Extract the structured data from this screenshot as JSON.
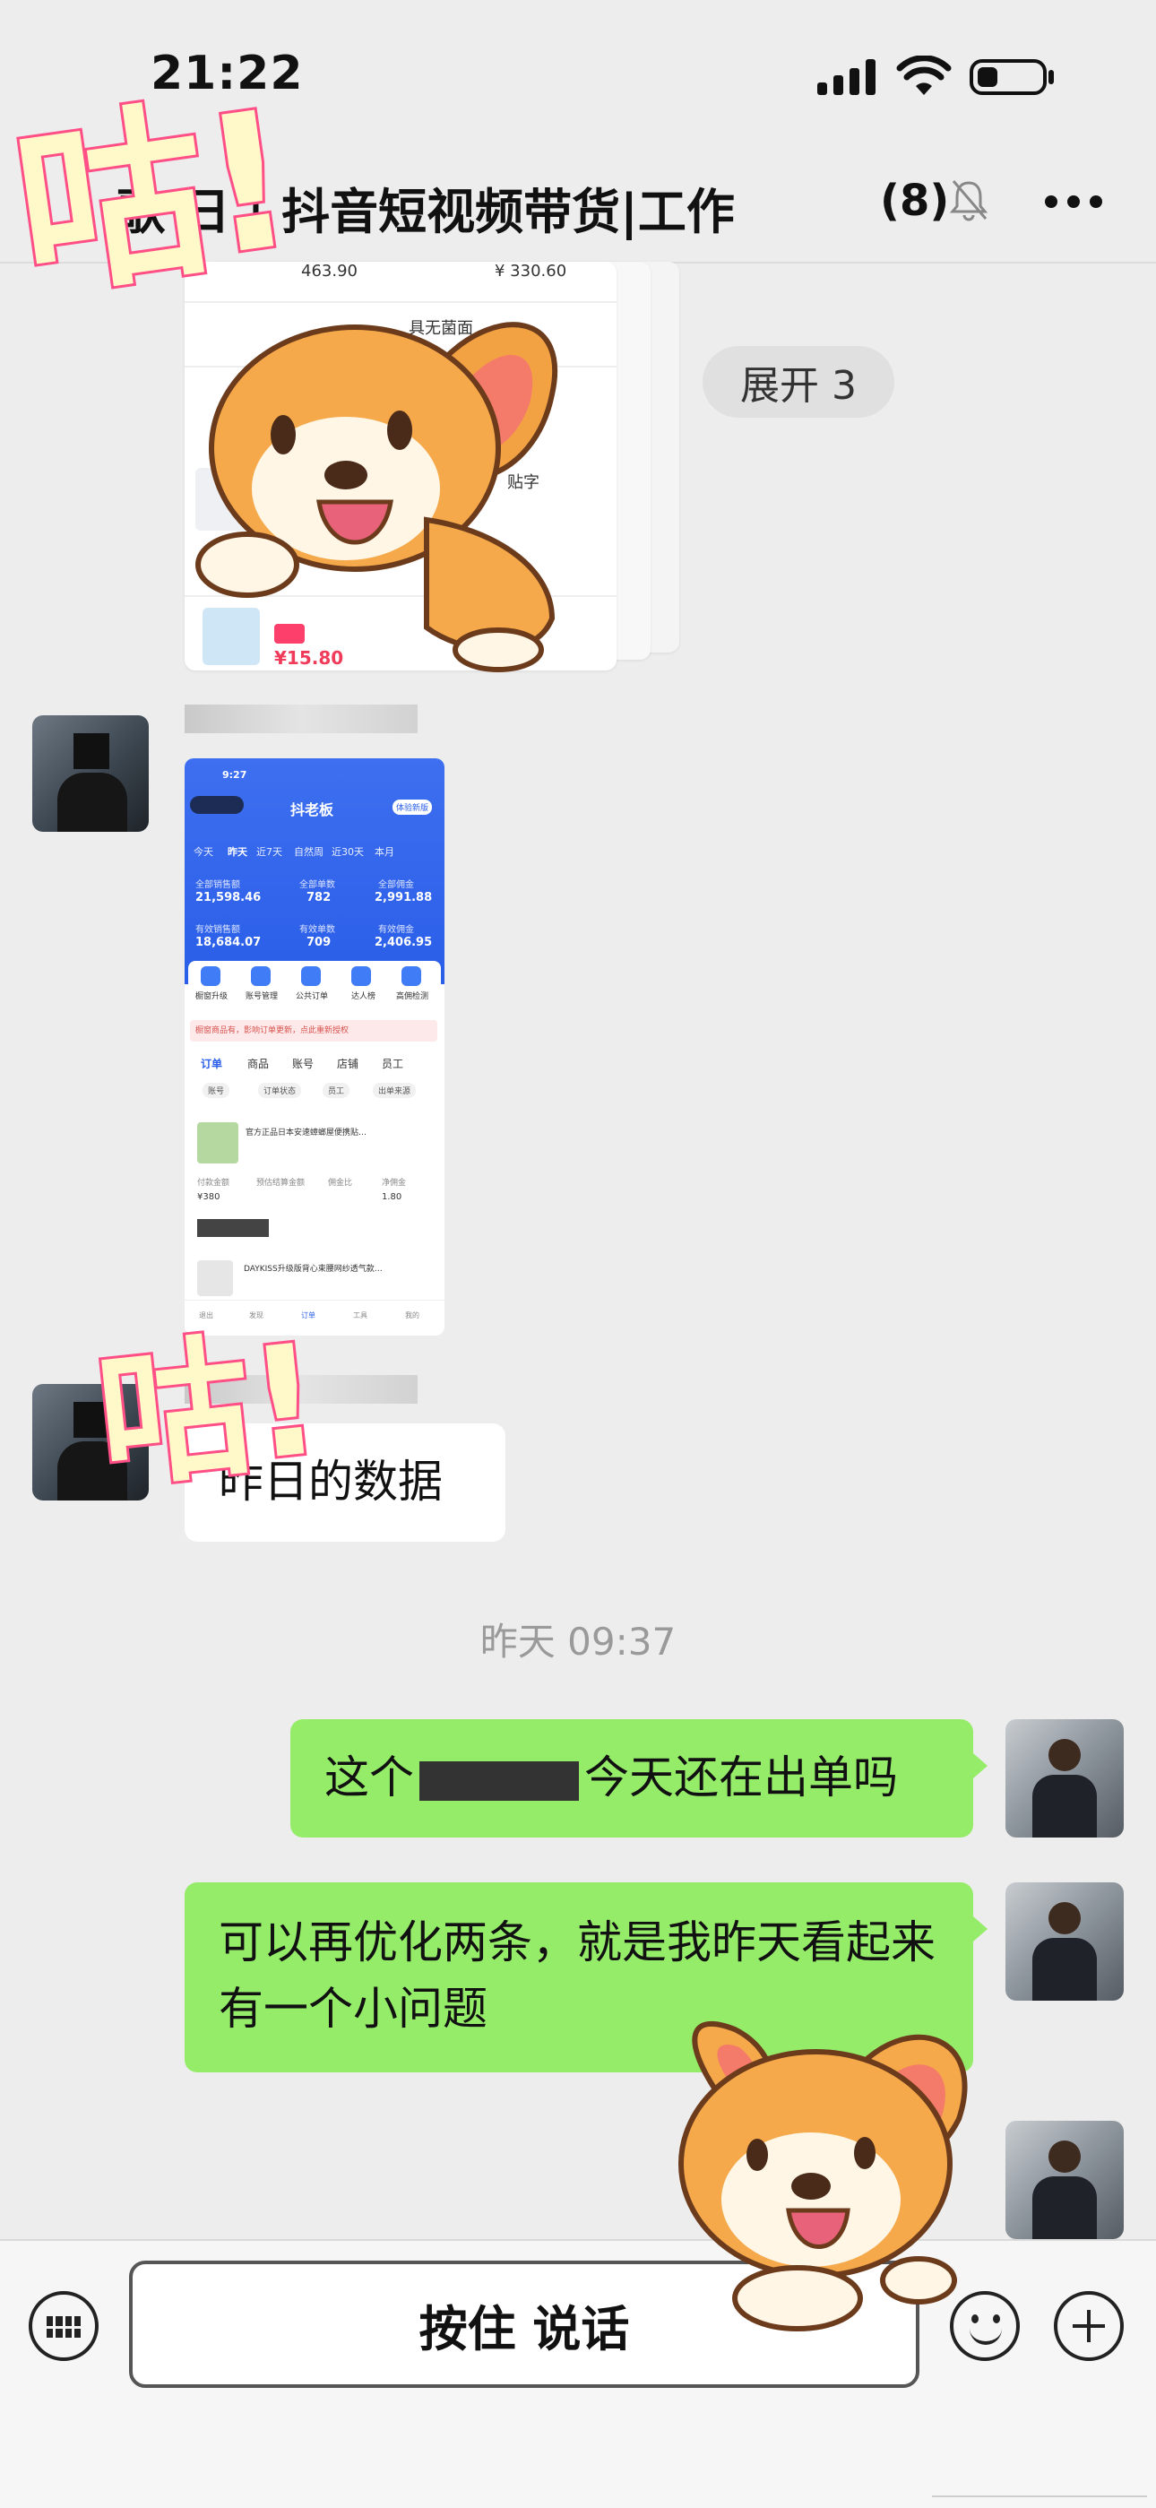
{
  "status_bar": {
    "time": "21:22"
  },
  "nav": {
    "title": "歌 日 | 抖音短视频带货|工作",
    "member_count": "(8)"
  },
  "forward_card": {
    "price_1": "463.90",
    "price_2": "¥ 330.60",
    "line_3": "具无菌面",
    "line_4": "贴字",
    "price_bottom": "¥15.80"
  },
  "expand_pill": {
    "label": "展开 3"
  },
  "sticker_1": {
    "text": "咕!"
  },
  "sticker_2": {
    "text": "咕!"
  },
  "msg_screenshot": {
    "status_time": "9:27",
    "app_name": "抖老板",
    "badge": "体验新版",
    "tabs": [
      "今天",
      "昨天",
      "近7天",
      "自然周",
      "近30天",
      "本月"
    ],
    "stats": [
      {
        "label": "全部销售额",
        "value": "21,598.46"
      },
      {
        "label": "全部单数",
        "value": "782"
      },
      {
        "label": "全部佣金",
        "value": "2,991.88"
      },
      {
        "label": "有效销售额",
        "value": "18,684.07"
      },
      {
        "label": "有效单数",
        "value": "709"
      },
      {
        "label": "有效佣金",
        "value": "2,406.95"
      }
    ],
    "icons": [
      "橱窗升级",
      "账号管理",
      "公共订单",
      "达人榜",
      "高佣检测"
    ],
    "notice": "橱窗商品有，影响订单更新，点此重新授权",
    "sub_tabs": [
      "订单",
      "商品",
      "账号",
      "店铺",
      "员工"
    ],
    "chips": [
      "账号",
      "订单状态",
      "员工",
      "出单来源"
    ],
    "order_title": "官方正品日本安速蟑螂屋便携贴…",
    "order_cols": [
      "付款金额",
      "预估结算金额",
      "佣金比",
      "净佣金"
    ],
    "order_vals": [
      "¥380",
      "",
      "",
      "1.80"
    ],
    "order_2": "DAYKISS升级版背心束腰网纱透气款…",
    "bottom_nav": [
      "退出",
      "发现",
      "订单",
      "工具",
      "我的"
    ]
  },
  "msg_text": {
    "text": "昨日的数据"
  },
  "timestamp": "昨天 09:37",
  "msg_out_1": {
    "text_a": "这个",
    "text_b": "今天还在出单吗"
  },
  "msg_out_2": {
    "text": "可以再优化两条，就是我昨天看起来有一个小问题"
  },
  "bottom_bar": {
    "voice_label": "按住 说话"
  }
}
